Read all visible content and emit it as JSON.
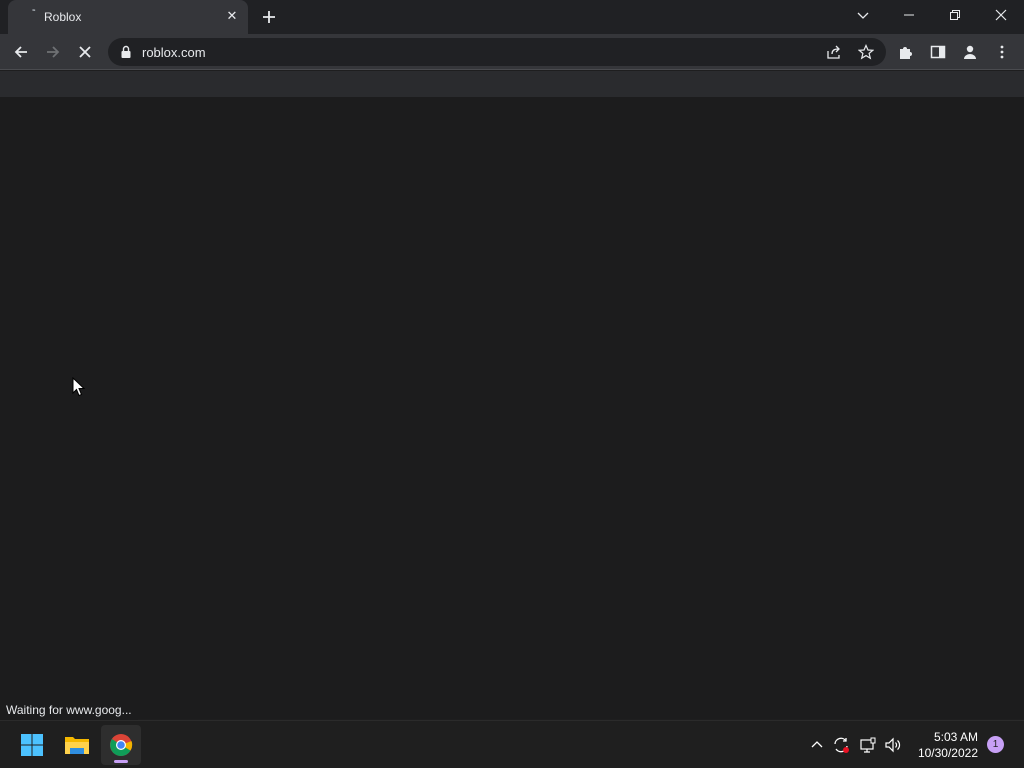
{
  "browser": {
    "tab": {
      "title": "Roblox",
      "close_glyph": "✕"
    },
    "address_bar": {
      "url": "roblox.com"
    },
    "status_bubble": "Waiting for www.goog..."
  },
  "icons": {
    "tab_favicon": "loading-spinner-icon",
    "new_tab": "plus-icon",
    "tab_search": "chevron-down-icon",
    "minimize": "minimize-icon",
    "restore": "restore-icon",
    "close": "close-icon",
    "back": "arrow-left-icon",
    "forward": "arrow-right-icon",
    "stop": "stop-loading-icon",
    "lock": "lock-icon",
    "share": "share-icon",
    "bookmark": "star-icon",
    "extensions": "puzzle-icon",
    "side_panel": "side-panel-icon",
    "profile": "profile-icon",
    "menu": "kebab-menu-icon"
  },
  "taskbar": {
    "apps": [
      {
        "name": "Start",
        "icon": "windows-start-icon"
      },
      {
        "name": "File Explorer",
        "icon": "folder-icon"
      },
      {
        "name": "Google Chrome",
        "icon": "chrome-icon",
        "active": true
      }
    ],
    "tray": {
      "time": "5:03 AM",
      "date": "10/30/2022",
      "notification_count": "1"
    }
  },
  "colors": {
    "tab_strip": "#202124",
    "toolbar": "#35363a",
    "page_background": "#1c1c1d",
    "taskbar": "#1f1f1f",
    "accent": "#c7a0f5"
  }
}
